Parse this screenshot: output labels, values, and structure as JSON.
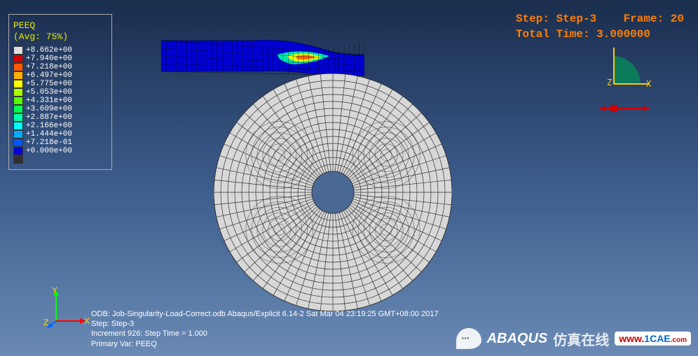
{
  "legend": {
    "title": "PEEQ",
    "subtitle": "(Avg: 75%)",
    "items": [
      {
        "color": "#e0e0e0",
        "value": "+8.662e+00"
      },
      {
        "color": "#d40000",
        "value": "+7.940e+00"
      },
      {
        "color": "#ff5a00",
        "value": "+7.218e+00"
      },
      {
        "color": "#ffb000",
        "value": "+6.497e+00"
      },
      {
        "color": "#ffff00",
        "value": "+5.775e+00"
      },
      {
        "color": "#aaff00",
        "value": "+5.053e+00"
      },
      {
        "color": "#55ff00",
        "value": "+4.331e+00"
      },
      {
        "color": "#00ff55",
        "value": "+3.609e+00"
      },
      {
        "color": "#00ffaa",
        "value": "+2.887e+00"
      },
      {
        "color": "#00ffff",
        "value": "+2.166e+00"
      },
      {
        "color": "#00aaff",
        "value": "+1.444e+00"
      },
      {
        "color": "#0055ff",
        "value": "+7.218e-01"
      },
      {
        "color": "#0000d4",
        "value": "+0.000e+00"
      },
      {
        "color": "#303030",
        "value": ""
      }
    ]
  },
  "step_info": {
    "line1_a": "Step: Step-3",
    "line1_b": "Frame: 20",
    "line2": "Total Time: 3.000000"
  },
  "axes": {
    "x": "X",
    "y": "Y",
    "z": "Z"
  },
  "odb_info": "ODB: Job-Singularity-Load-Correct.odb    Abaqus/Explicit 6.14-2    Sat Mar 04 23:19:25 GMT+08:00 2017",
  "step_detail": {
    "line1": "Step: Step-3",
    "line2": "Increment       926: Step Time =    1.000",
    "line3": "Primary Var: PEEQ"
  },
  "watermark": {
    "brand": "ABAQUS",
    "chinese": "仿真在线",
    "url": "www.1CAE.com"
  },
  "chart_data": {
    "type": "contour-plot",
    "variable": "PEEQ",
    "averaging": "75%",
    "scale_min": 0.0,
    "scale_max": 8.662,
    "levels": [
      0.0,
      0.7218,
      1.444,
      2.166,
      2.887,
      3.609,
      4.331,
      5.053,
      5.775,
      6.497,
      7.218,
      7.94,
      8.662
    ],
    "step": "Step-3",
    "frame": 20,
    "total_time": 3.0,
    "increment": 926,
    "step_time": 1.0,
    "primary_var": "PEEQ",
    "odb": "Job-Singularity-Load-Correct.odb",
    "solver": "Abaqus/Explicit 6.14-2",
    "timestamp": "Sat Mar 04 23:19:25 GMT+08:00 2017"
  }
}
